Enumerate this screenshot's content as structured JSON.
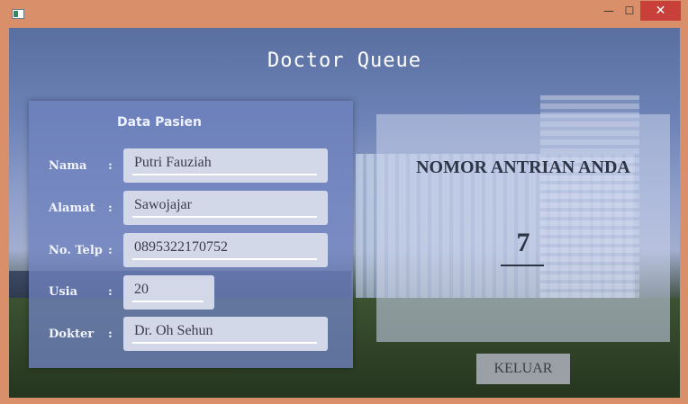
{
  "window": {
    "minimize_label": "—",
    "maximize_label": "☐",
    "close_label": "✕"
  },
  "app": {
    "title": "Doctor Queue"
  },
  "form": {
    "heading": "Data Pasien",
    "fields": [
      {
        "label": "Nama",
        "colon": ":",
        "value": "Putri Fauziah"
      },
      {
        "label": "Alamat",
        "colon": ":",
        "value": "Sawojajar"
      },
      {
        "label": "No. Telp",
        "colon": ":",
        "value": "0895322170752"
      },
      {
        "label": "Usia",
        "colon": ":",
        "value": "20"
      },
      {
        "label": "Dokter",
        "colon": ":",
        "value": "Dr. Oh Sehun"
      }
    ]
  },
  "queue": {
    "label": "NOMOR ANTRIAN ANDA",
    "number": "7"
  },
  "exit_button": {
    "label": "KELUAR"
  }
}
